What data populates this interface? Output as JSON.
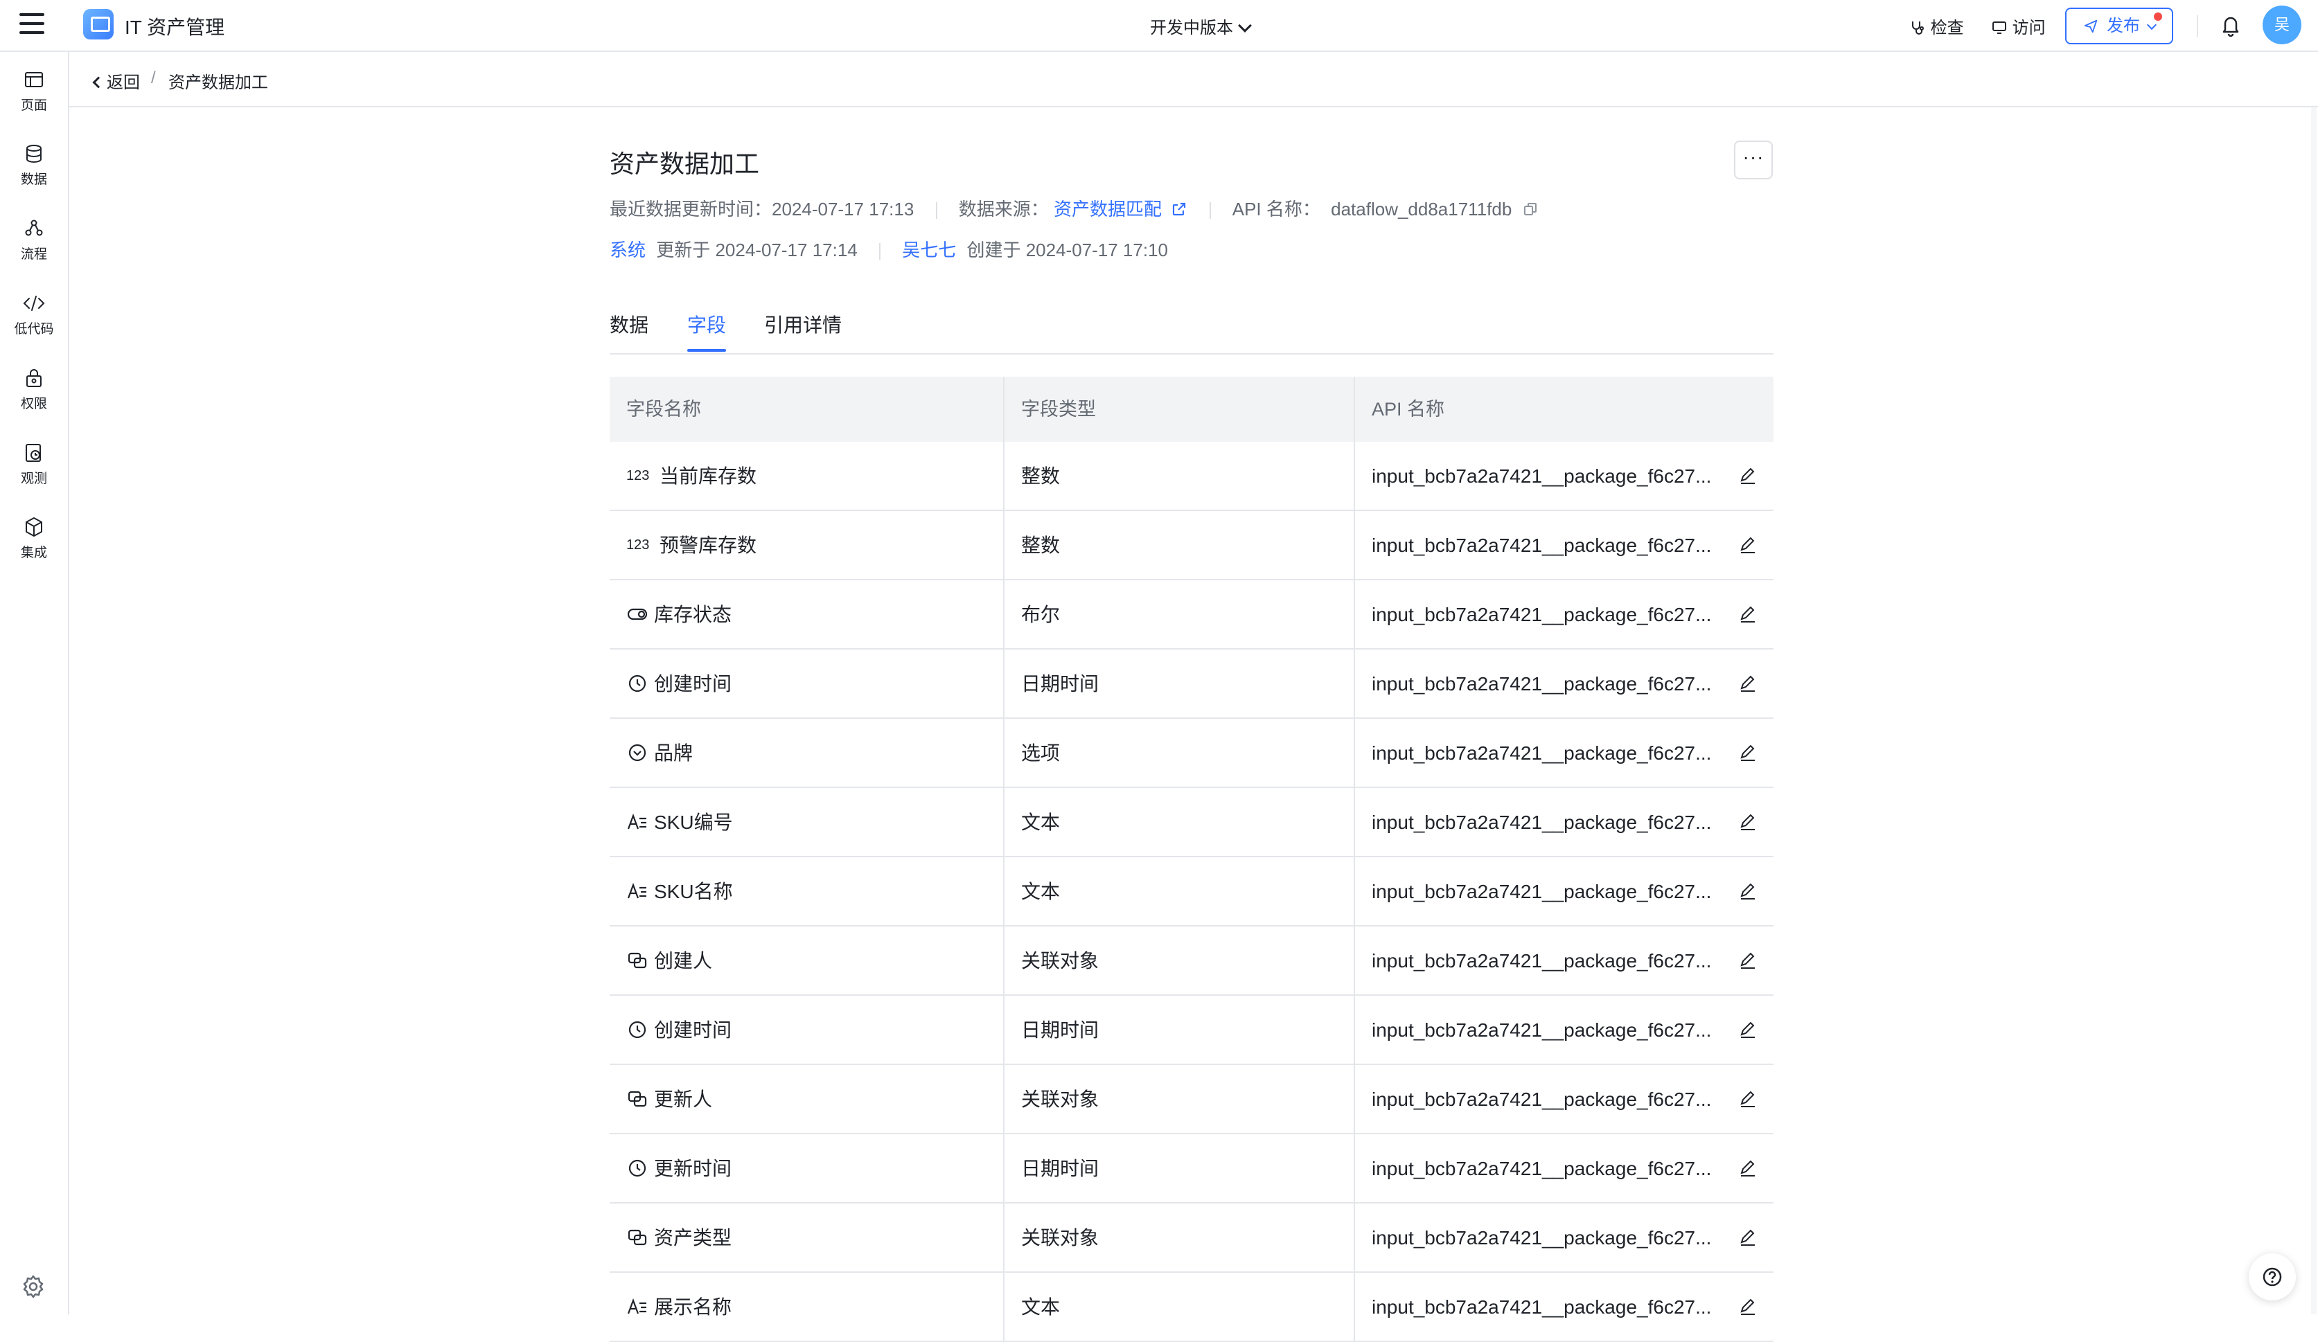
{
  "topbar": {
    "app_title": "IT 资产管理",
    "version_label": "开发中版本",
    "inspect_label": "检查",
    "visit_label": "访问",
    "publish_label": "发布",
    "avatar_text": "吴"
  },
  "sidebar": {
    "items": [
      {
        "label": "页面",
        "icon": "page-icon"
      },
      {
        "label": "数据",
        "icon": "database-icon"
      },
      {
        "label": "流程",
        "icon": "flow-icon"
      },
      {
        "label": "低代码",
        "icon": "code-icon"
      },
      {
        "label": "权限",
        "icon": "lock-icon"
      },
      {
        "label": "观测",
        "icon": "observe-icon"
      },
      {
        "label": "集成",
        "icon": "cube-icon"
      }
    ],
    "settings_icon": "gear-icon"
  },
  "breadcrumb": {
    "back_label": "返回",
    "separator": "/",
    "current": "资产数据加工"
  },
  "page": {
    "title": "资产数据加工",
    "more_label": "···",
    "meta": {
      "last_update_label": "最近数据更新时间：",
      "last_update_value": "2024-07-17 17:13",
      "source_label": "数据来源：",
      "source_value": "资产数据匹配",
      "api_label": "API 名称：",
      "api_value": "dataflow_dd8a1711fdb"
    },
    "audit": {
      "updater": "系统",
      "updated_text": "更新于 2024-07-17 17:14",
      "creator": "吴七七",
      "created_text": "创建于 2024-07-17 17:10"
    },
    "tabs": [
      {
        "label": "数据",
        "active": false
      },
      {
        "label": "字段",
        "active": true
      },
      {
        "label": "引用详情",
        "active": false
      }
    ]
  },
  "table": {
    "headers": [
      "字段名称",
      "字段类型",
      "API 名称"
    ],
    "rows": [
      {
        "icon": "number-icon",
        "name": "当前库存数",
        "type": "整数",
        "api": "input_bcb7a2a7421__package_f6c27..."
      },
      {
        "icon": "number-icon",
        "name": "预警库存数",
        "type": "整数",
        "api": "input_bcb7a2a7421__package_f6c27..."
      },
      {
        "icon": "toggle-icon",
        "name": "库存状态",
        "type": "布尔",
        "api": "input_bcb7a2a7421__package_f6c27..."
      },
      {
        "icon": "clock-icon",
        "name": "创建时间",
        "type": "日期时间",
        "api": "input_bcb7a2a7421__package_f6c27..."
      },
      {
        "icon": "option-icon",
        "name": "品牌",
        "type": "选项",
        "api": "input_bcb7a2a7421__package_f6c27..."
      },
      {
        "icon": "text-icon",
        "name": "SKU编号",
        "type": "文本",
        "api": "input_bcb7a2a7421__package_f6c27..."
      },
      {
        "icon": "text-icon",
        "name": "SKU名称",
        "type": "文本",
        "api": "input_bcb7a2a7421__package_f6c27..."
      },
      {
        "icon": "link-icon",
        "name": "创建人",
        "type": "关联对象",
        "api": "input_bcb7a2a7421__package_f6c27..."
      },
      {
        "icon": "clock-icon",
        "name": "创建时间",
        "type": "日期时间",
        "api": "input_bcb7a2a7421__package_f6c27..."
      },
      {
        "icon": "link-icon",
        "name": "更新人",
        "type": "关联对象",
        "api": "input_bcb7a2a7421__package_f6c27..."
      },
      {
        "icon": "clock-icon",
        "name": "更新时间",
        "type": "日期时间",
        "api": "input_bcb7a2a7421__package_f6c27..."
      },
      {
        "icon": "link-icon",
        "name": "资产类型",
        "type": "关联对象",
        "api": "input_bcb7a2a7421__package_f6c27..."
      },
      {
        "icon": "text-icon",
        "name": "展示名称",
        "type": "文本",
        "api": "input_bcb7a2a7421__package_f6c27..."
      }
    ]
  },
  "colors": {
    "accent": "#3370ff",
    "text": "#1f2329",
    "muted": "#646a73",
    "border": "#e4e6ea",
    "header_bg": "#f2f3f5"
  }
}
